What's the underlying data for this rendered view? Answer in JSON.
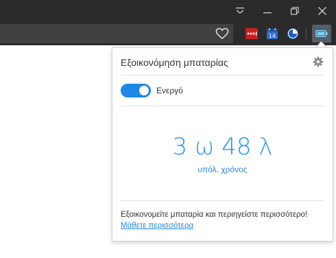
{
  "browser": {
    "window_controls": [
      "menu",
      "minimize",
      "restore",
      "close"
    ],
    "extensions": [
      {
        "name": "lastpass-icon",
        "color": "#cc1f1f"
      },
      {
        "name": "calendar-icon",
        "color": "#2f6fd6",
        "text": "14"
      },
      {
        "name": "pie-extension-icon",
        "color": "#1f5fb5"
      }
    ],
    "active_extension": "battery-saver"
  },
  "panel": {
    "title": "Εξοικονόμηση μπαταρίας",
    "toggle": {
      "label": "Ενεργό",
      "on": true
    },
    "remaining_time": "3 ω 48 λ",
    "remaining_caption": "υπόλ. χρόνος",
    "info": "Εξοικονομείτε μπαταρία και περιηγείστε περισσότερο!",
    "learn_more": "Μάθετε περισσότερα"
  },
  "colors": {
    "accent": "#1f87e5",
    "titlebar": "#2b2b2b"
  }
}
